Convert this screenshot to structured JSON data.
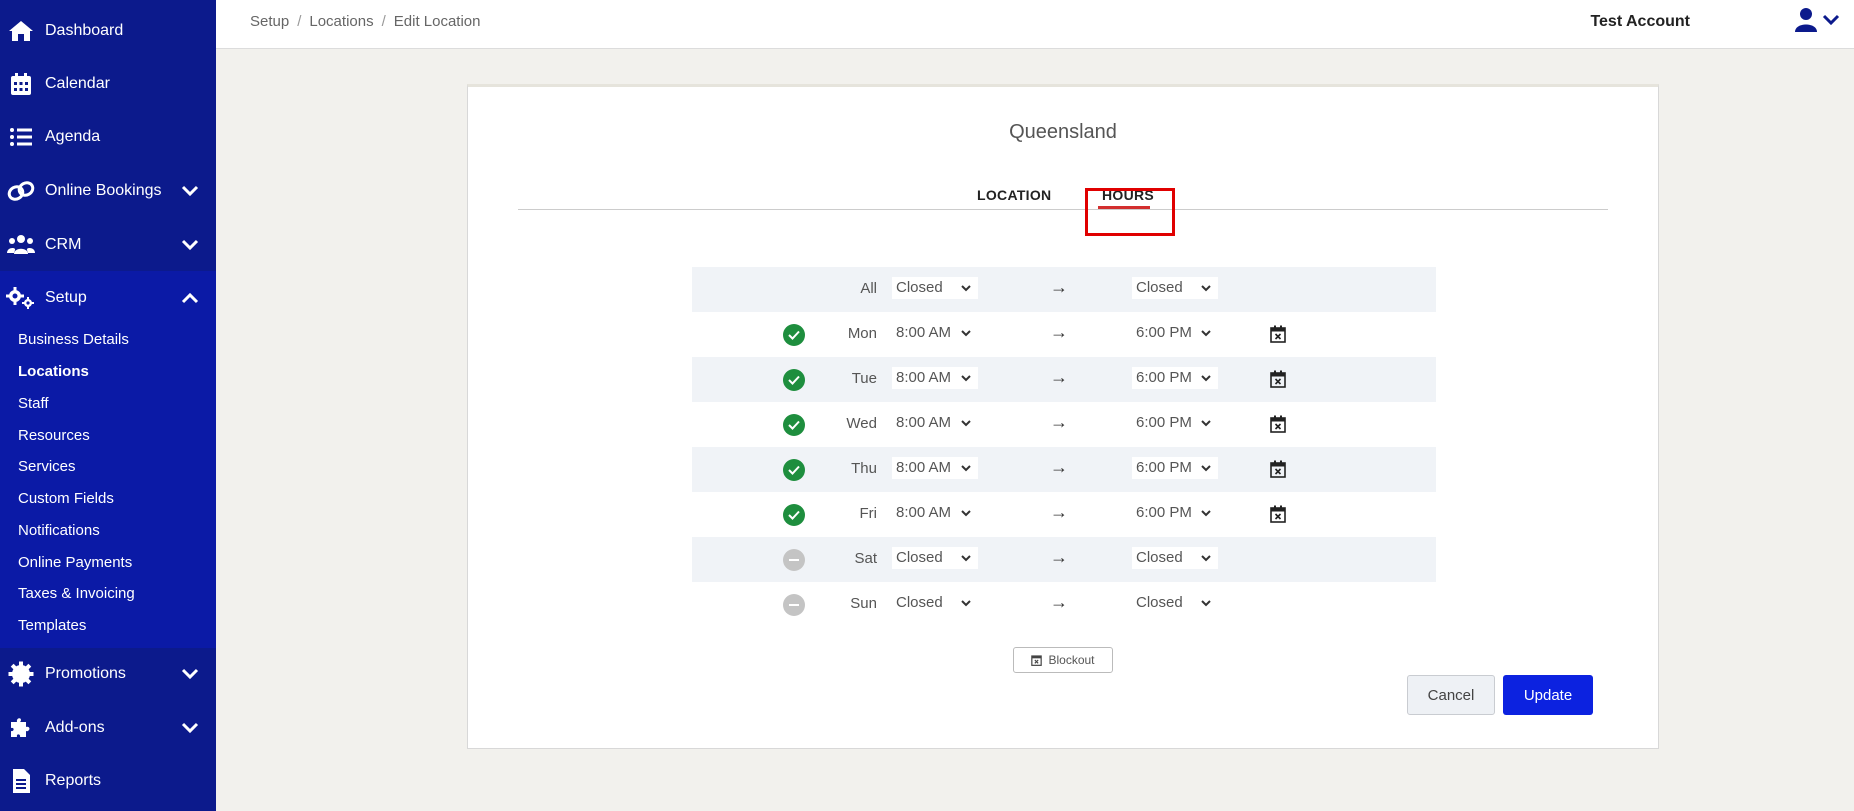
{
  "sidebar": {
    "items": [
      {
        "label": "Dashboard",
        "icon": "home-icon"
      },
      {
        "label": "Calendar",
        "icon": "calendar-icon"
      },
      {
        "label": "Agenda",
        "icon": "list-icon"
      },
      {
        "label": "Online Bookings",
        "icon": "link-icon"
      },
      {
        "label": "CRM",
        "icon": "users-icon"
      },
      {
        "label": "Setup",
        "icon": "cogs-icon"
      },
      {
        "label": "Promotions",
        "icon": "badge-icon"
      },
      {
        "label": "Add-ons",
        "icon": "puzzle-icon"
      },
      {
        "label": "Reports",
        "icon": "document-icon"
      }
    ],
    "setup_sub": [
      "Business Details",
      "Locations",
      "Staff",
      "Resources",
      "Services",
      "Custom Fields",
      "Notifications",
      "Online Payments",
      "Taxes & Invoicing",
      "Templates"
    ],
    "current_sub": "Locations"
  },
  "header": {
    "breadcrumb": [
      "Setup",
      "Locations",
      "Edit Location"
    ],
    "account_name": "Test Account"
  },
  "card": {
    "title": "Queensland",
    "tabs": {
      "location": "LOCATION",
      "hours": "HOURS"
    },
    "active_tab": "HOURS"
  },
  "hours": {
    "arrow": "→",
    "rows": [
      {
        "day": "All",
        "status": "none",
        "open": "Closed",
        "close": "Closed",
        "calendar": false
      },
      {
        "day": "Mon",
        "status": "open",
        "open": "8:00 AM",
        "close": "6:00 PM",
        "calendar": true
      },
      {
        "day": "Tue",
        "status": "open",
        "open": "8:00 AM",
        "close": "6:00 PM",
        "calendar": true
      },
      {
        "day": "Wed",
        "status": "open",
        "open": "8:00 AM",
        "close": "6:00 PM",
        "calendar": true
      },
      {
        "day": "Thu",
        "status": "open",
        "open": "8:00 AM",
        "close": "6:00 PM",
        "calendar": true
      },
      {
        "day": "Fri",
        "status": "open",
        "open": "8:00 AM",
        "close": "6:00 PM",
        "calendar": true
      },
      {
        "day": "Sat",
        "status": "closed",
        "open": "Closed",
        "close": "Closed",
        "calendar": false
      },
      {
        "day": "Sun",
        "status": "closed",
        "open": "Closed",
        "close": "Closed",
        "calendar": false
      }
    ]
  },
  "actions": {
    "blockout": "Blockout",
    "cancel": "Cancel",
    "update": "Update"
  },
  "colors": {
    "sidebar": "#0c1a8c",
    "accent_tab": "#d32f2f",
    "highlight": "#e00000",
    "update_button": "#0c22e0",
    "status_open": "#1e8e3e",
    "status_closed": "#c4c4c4"
  }
}
